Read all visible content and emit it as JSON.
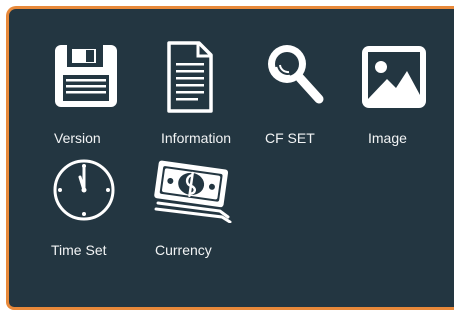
{
  "menu": {
    "items": [
      {
        "label": "Version",
        "icon": "floppy-disk-icon"
      },
      {
        "label": "Information",
        "icon": "document-icon"
      },
      {
        "label": "CF SET",
        "icon": "magnifier-icon"
      },
      {
        "label": "Image",
        "icon": "picture-icon"
      },
      {
        "label": "Time Set",
        "icon": "clock-icon"
      },
      {
        "label": "Currency",
        "icon": "banknotes-icon"
      }
    ]
  },
  "colors": {
    "background": "#233641",
    "border": "#e8893a",
    "icon": "#ffffff",
    "text": "#f2f4f5"
  }
}
